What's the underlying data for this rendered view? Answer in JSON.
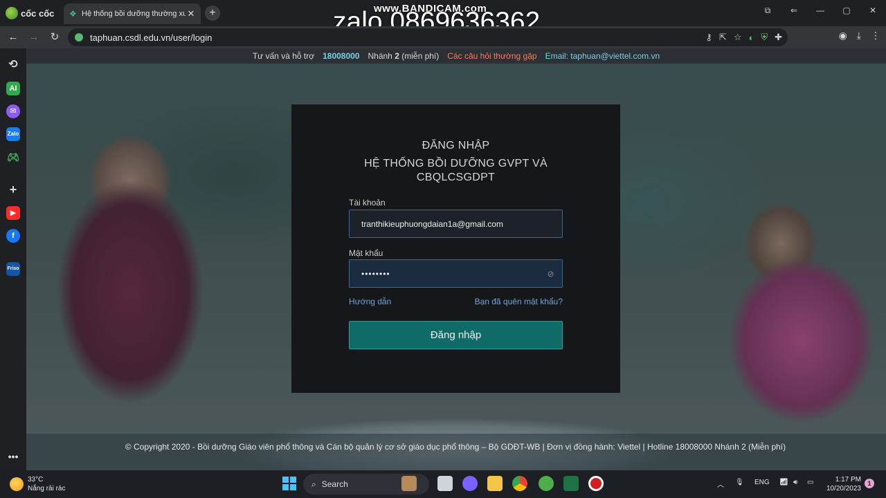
{
  "browser": {
    "brand": "cốc cốc",
    "tab_title": "Hệ thống bồi dưỡng thường xuy",
    "url": "taphuan.csdl.edu.vn/user/login"
  },
  "watermark": {
    "bandicam": "www.BANDICAM.com",
    "zalo": "zalo 0869636362"
  },
  "topbar": {
    "support_label": "Tư vấn và hỗ trợ",
    "hotline": "18008000",
    "branch_label": "Nhánh",
    "branch_number": "2",
    "branch_note": "(miễn phí)",
    "faq": "Các câu hỏi thường gặp",
    "email": "Email: taphuan@viettel.com.vn"
  },
  "login": {
    "heading": "ĐĂNG NHẬP",
    "system_name": "HỆ THỐNG BỒI DƯỠNG GVPT VÀ CBQLCSGDPT",
    "account_label": "Tài khoản",
    "account_value": "tranthikieuphuongdaian1a@gmail.com",
    "password_label": "Mật khẩu",
    "password_value": "••••••••",
    "guide_link": "Hướng dẫn",
    "forgot_link": "Bạn đã quên mật khẩu?",
    "submit": "Đăng nhập"
  },
  "footer": {
    "text": "© Copyright 2020 - Bồi dưỡng Giáo viên phổ thông và Cán bộ quản lý cơ sở giáo dục phổ thông – Bộ GDĐT-WB | Đơn vị đồng hành: Viettel | Hotline 18008000 Nhánh 2 (Miễn phí)"
  },
  "taskbar": {
    "temperature": "33°C",
    "weather": "Nắng rải rác",
    "search": "Search",
    "language": "ENG",
    "time": "1:17 PM",
    "date": "10/20/2023",
    "notifications": "1"
  },
  "colors": {
    "accent_button": "#0f6b68",
    "link": "#6fa7db",
    "faq": "#ff7a5a",
    "hotline": "#7ad0e6"
  }
}
